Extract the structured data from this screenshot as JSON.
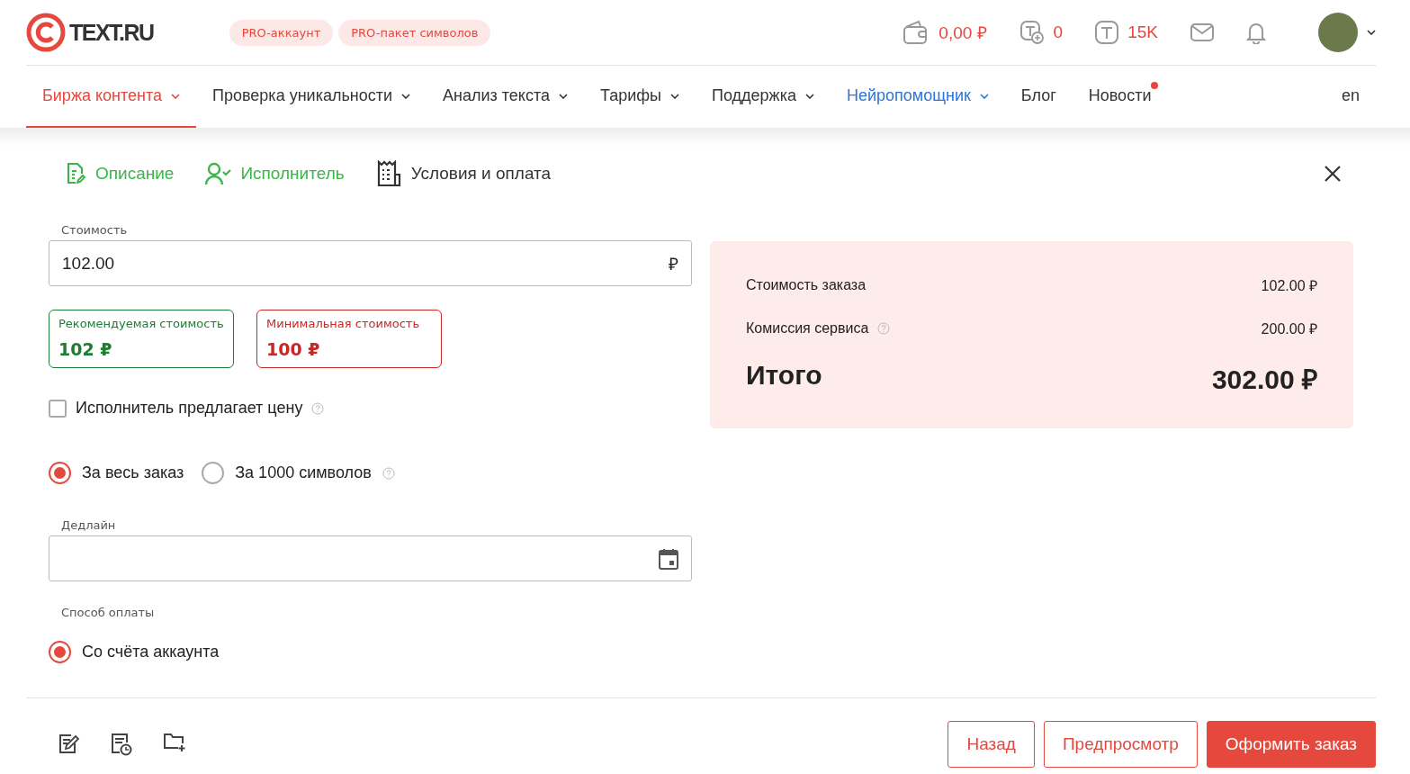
{
  "logo": {
    "text": "TEXT.RU"
  },
  "pro_badges": [
    "PRO-аккаунт",
    "PRO-пакет символов"
  ],
  "stats": [
    {
      "kind": "wallet",
      "value": "0,00 ₽"
    },
    {
      "kind": "token-add",
      "value": "0"
    },
    {
      "kind": "token",
      "value": "15K"
    }
  ],
  "nav": [
    {
      "label": "Биржа контента",
      "selected": true,
      "dropdown": true,
      "kind": "normal",
      "dot": false
    },
    {
      "label": "Проверка уникальности",
      "selected": false,
      "dropdown": true,
      "kind": "normal",
      "dot": false
    },
    {
      "label": "Анализ текста",
      "selected": false,
      "dropdown": true,
      "kind": "normal",
      "dot": false
    },
    {
      "label": "Тарифы",
      "selected": false,
      "dropdown": true,
      "kind": "normal",
      "dot": false
    },
    {
      "label": "Поддержка",
      "selected": false,
      "dropdown": true,
      "kind": "normal",
      "dot": false
    },
    {
      "label": "Нейропомощник",
      "selected": false,
      "dropdown": true,
      "kind": "accent",
      "dot": false
    },
    {
      "label": "Блог",
      "selected": false,
      "dropdown": false,
      "kind": "normal",
      "dot": false
    },
    {
      "label": "Новости",
      "selected": false,
      "dropdown": false,
      "kind": "normal",
      "dot": true
    },
    {
      "label": "en",
      "selected": false,
      "dropdown": false,
      "kind": "normal",
      "dot": false
    }
  ],
  "steps": [
    {
      "kind": "description",
      "label": "Описание",
      "done": true
    },
    {
      "kind": "performer",
      "label": "Исполнитель",
      "done": true
    },
    {
      "kind": "terms",
      "label": "Условия и оплата",
      "done": false
    }
  ],
  "price_field": {
    "label": "Стоимость",
    "value": "102.00",
    "suffix": "₽"
  },
  "price_hints": [
    {
      "kind": "recommended",
      "label": "Рекомендуемая стоимость",
      "value": "102 ₽"
    },
    {
      "kind": "minimum",
      "label": "Минимальная стоимость",
      "value": "100 ₽"
    }
  ],
  "offer_checkbox": {
    "label": "Исполнитель предлагает цену",
    "checked": false
  },
  "price_mode": [
    {
      "label": "За весь заказ",
      "selected": true,
      "help": false
    },
    {
      "label": "За 1000 символов",
      "selected": false,
      "help": true
    }
  ],
  "deadline": {
    "label": "Дедлайн"
  },
  "payment": {
    "label": "Способ оплаты",
    "options": [
      {
        "label": "Со счёта аккаунта",
        "selected": true
      }
    ]
  },
  "summary": {
    "rows": [
      {
        "label": "Стоимость заказа",
        "value": "102.00 ₽",
        "help": false
      },
      {
        "label": "Комиссия сервиса",
        "value": "200.00 ₽",
        "help": true
      }
    ],
    "total": {
      "label": "Итого",
      "value": "302.00 ₽"
    }
  },
  "footer_buttons": [
    {
      "label": "Назад",
      "kind": "secondary"
    },
    {
      "label": "Предпросмотр",
      "kind": "secondary"
    },
    {
      "label": "Оформить заказ",
      "kind": "primary"
    }
  ]
}
